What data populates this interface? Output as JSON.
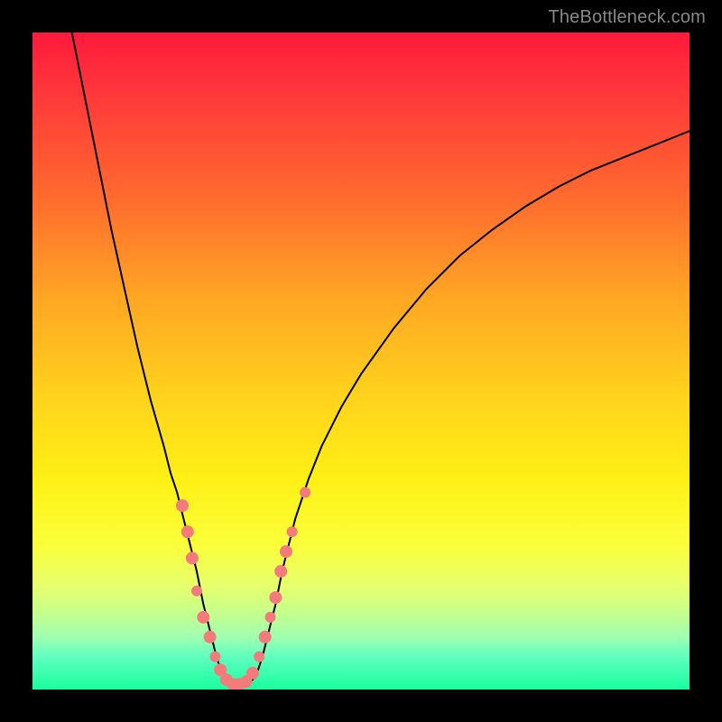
{
  "watermark": "TheBottleneck.com",
  "chart_data": {
    "type": "line",
    "title": "",
    "xlabel": "",
    "ylabel": "",
    "xlim": [
      0,
      100
    ],
    "ylim": [
      0,
      100
    ],
    "annotations": [],
    "series": [
      {
        "name": "bottleneck-curve",
        "points": [
          {
            "x": 6,
            "y": 100
          },
          {
            "x": 8,
            "y": 90
          },
          {
            "x": 10,
            "y": 80
          },
          {
            "x": 12,
            "y": 70
          },
          {
            "x": 14,
            "y": 61
          },
          {
            "x": 16,
            "y": 52
          },
          {
            "x": 18,
            "y": 44
          },
          {
            "x": 20,
            "y": 37
          },
          {
            "x": 21,
            "y": 33
          },
          {
            "x": 22,
            "y": 30
          },
          {
            "x": 23,
            "y": 26
          },
          {
            "x": 24,
            "y": 22
          },
          {
            "x": 25,
            "y": 18
          },
          {
            "x": 26,
            "y": 13
          },
          {
            "x": 27,
            "y": 9
          },
          {
            "x": 28,
            "y": 5
          },
          {
            "x": 29,
            "y": 2
          },
          {
            "x": 30,
            "y": 1
          },
          {
            "x": 31,
            "y": 0.7
          },
          {
            "x": 32,
            "y": 0.7
          },
          {
            "x": 33,
            "y": 1
          },
          {
            "x": 34,
            "y": 2
          },
          {
            "x": 35,
            "y": 5
          },
          {
            "x": 36,
            "y": 9
          },
          {
            "x": 37,
            "y": 13
          },
          {
            "x": 38,
            "y": 18
          },
          {
            "x": 39,
            "y": 22
          },
          {
            "x": 40,
            "y": 26
          },
          {
            "x": 42,
            "y": 32
          },
          {
            "x": 44,
            "y": 37
          },
          {
            "x": 47,
            "y": 43
          },
          {
            "x": 50,
            "y": 48
          },
          {
            "x": 55,
            "y": 55
          },
          {
            "x": 60,
            "y": 61
          },
          {
            "x": 65,
            "y": 66
          },
          {
            "x": 70,
            "y": 70
          },
          {
            "x": 75,
            "y": 73.5
          },
          {
            "x": 80,
            "y": 76.5
          },
          {
            "x": 85,
            "y": 79
          },
          {
            "x": 90,
            "y": 81
          },
          {
            "x": 95,
            "y": 83
          },
          {
            "x": 100,
            "y": 85
          }
        ]
      },
      {
        "name": "scatter-dots",
        "points": [
          {
            "x": 22.8,
            "y": 28,
            "r": 7
          },
          {
            "x": 23.6,
            "y": 24,
            "r": 7
          },
          {
            "x": 24.3,
            "y": 20,
            "r": 7
          },
          {
            "x": 25.0,
            "y": 15,
            "r": 6
          },
          {
            "x": 26.0,
            "y": 11,
            "r": 7
          },
          {
            "x": 27.0,
            "y": 8,
            "r": 7
          },
          {
            "x": 27.8,
            "y": 5,
            "r": 6
          },
          {
            "x": 28.6,
            "y": 3,
            "r": 7
          },
          {
            "x": 29.5,
            "y": 1.5,
            "r": 7
          },
          {
            "x": 30.5,
            "y": 0.8,
            "r": 7
          },
          {
            "x": 31.5,
            "y": 0.8,
            "r": 7
          },
          {
            "x": 32.5,
            "y": 1.2,
            "r": 7
          },
          {
            "x": 33.5,
            "y": 2.5,
            "r": 7
          },
          {
            "x": 34.5,
            "y": 5,
            "r": 6
          },
          {
            "x": 35.4,
            "y": 8,
            "r": 7
          },
          {
            "x": 36.2,
            "y": 11,
            "r": 6
          },
          {
            "x": 37.0,
            "y": 14,
            "r": 7
          },
          {
            "x": 37.8,
            "y": 18,
            "r": 7
          },
          {
            "x": 38.6,
            "y": 21,
            "r": 7
          },
          {
            "x": 39.5,
            "y": 24,
            "r": 6
          },
          {
            "x": 41.5,
            "y": 30,
            "r": 6
          }
        ]
      }
    ]
  }
}
